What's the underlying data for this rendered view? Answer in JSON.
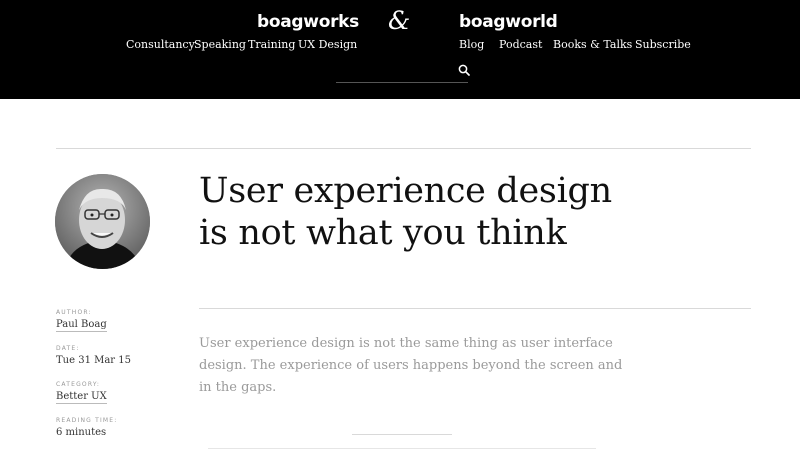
{
  "header": {
    "brand_left": "boagworks",
    "ampersand": "&",
    "brand_right": "boagworld",
    "nav_left": [
      "Consultancy",
      "Speaking",
      "Training",
      "UX Design"
    ],
    "nav_right": [
      "Blog",
      "Podcast",
      "Books & Talks",
      "Subscribe"
    ],
    "search": {
      "value": "",
      "placeholder": "",
      "icon": "search-icon"
    }
  },
  "article": {
    "title_lines": [
      "User experience design",
      "is not what you think"
    ],
    "intro_lines": [
      "User experience design is not the same thing as user interface",
      "design. The experience of users happens beyond the screen and",
      "in the gaps."
    ],
    "meta": {
      "author_label": "AUTHOR:",
      "author": "Paul Boag",
      "date_label": "DATE:",
      "date": "Tue 31 Mar 15",
      "category_label": "CATEGORY:",
      "category": "Better UX",
      "reading_label": "READING TIME:",
      "reading": "6 minutes"
    }
  },
  "colors": {
    "header_bg": "#000000",
    "body_bg": "#ffffff",
    "muted_text": "#9a9a9a"
  }
}
